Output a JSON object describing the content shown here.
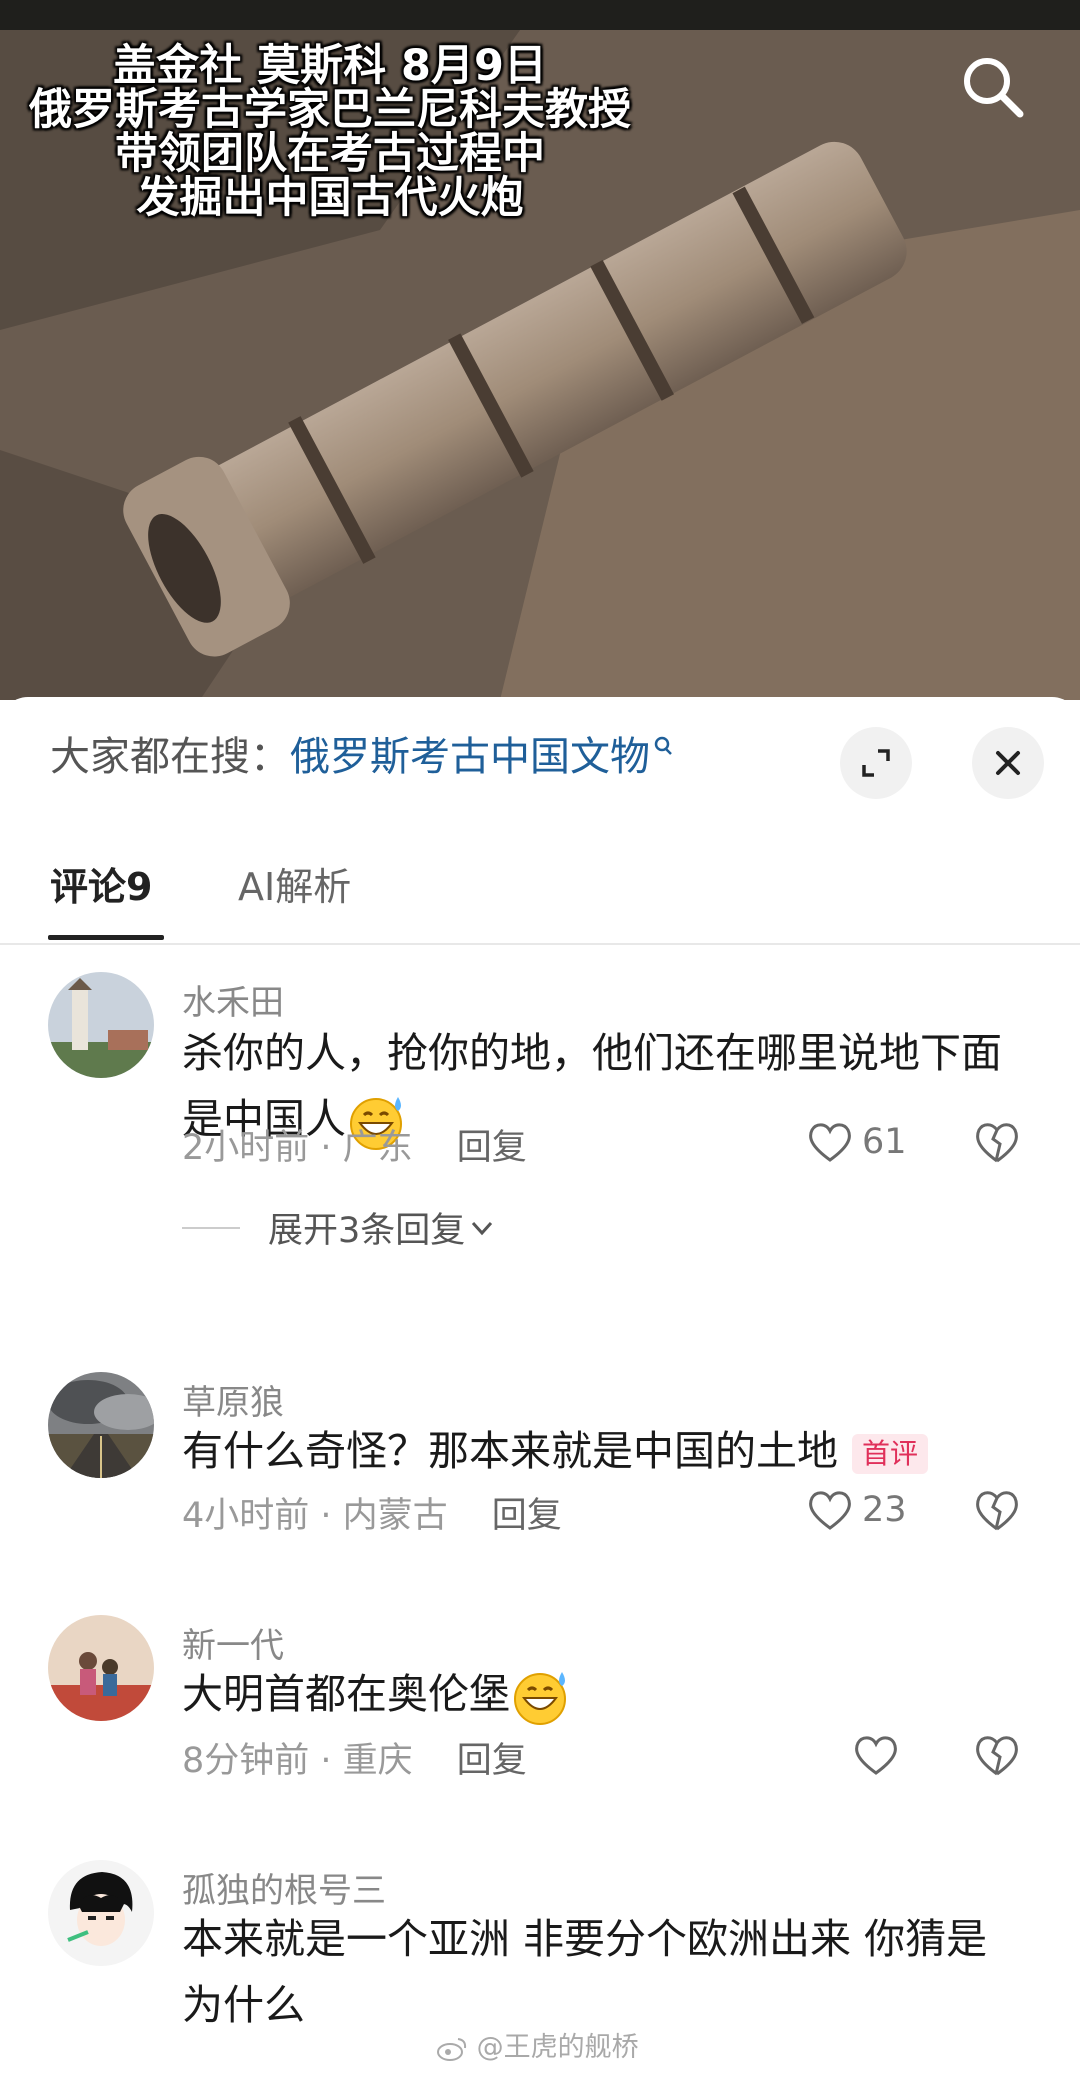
{
  "video": {
    "caption_lines": [
      "盖金社 莫斯科 8月9日",
      "俄罗斯考古学家巴兰尼科夫教授",
      "带领团队在考古过程中",
      "发掘出中国古代火炮"
    ]
  },
  "search_suggestion": {
    "label": "大家都在搜：",
    "query": "俄罗斯考古中国文物"
  },
  "tabs": [
    {
      "label": "评论9",
      "active": true
    },
    {
      "label": "AI解析",
      "active": false
    }
  ],
  "comments": [
    {
      "username": "水禾田",
      "text": "杀你的人，抢你的地，他们还在哪里说地下面是中国人",
      "emoji": "grinning-sweat-emoji",
      "time": "2小时前",
      "location": "广东",
      "reply_label": "回复",
      "likes": "61",
      "expand_label": "展开3条回复"
    },
    {
      "username": "草原狼",
      "text": "有什么奇怪？那本来就是中国的土地",
      "badge": "首评",
      "time": "4小时前",
      "location": "内蒙古",
      "reply_label": "回复",
      "likes": "23"
    },
    {
      "username": "新一代",
      "text": "大明首都在奥伦堡",
      "emoji": "grinning-sweat-emoji",
      "time": "8分钟前",
      "location": "重庆",
      "reply_label": "回复",
      "likes": ""
    },
    {
      "username": "孤独的根号三",
      "text": "本来就是一个亚洲 非要分个欧洲出来 你猜是为什么"
    }
  ],
  "watermark": "@王虎的舰桥",
  "colors": {
    "query_link": "#1f5f99",
    "badge_text": "#e0305a",
    "badge_bg": "#fde8ec"
  }
}
